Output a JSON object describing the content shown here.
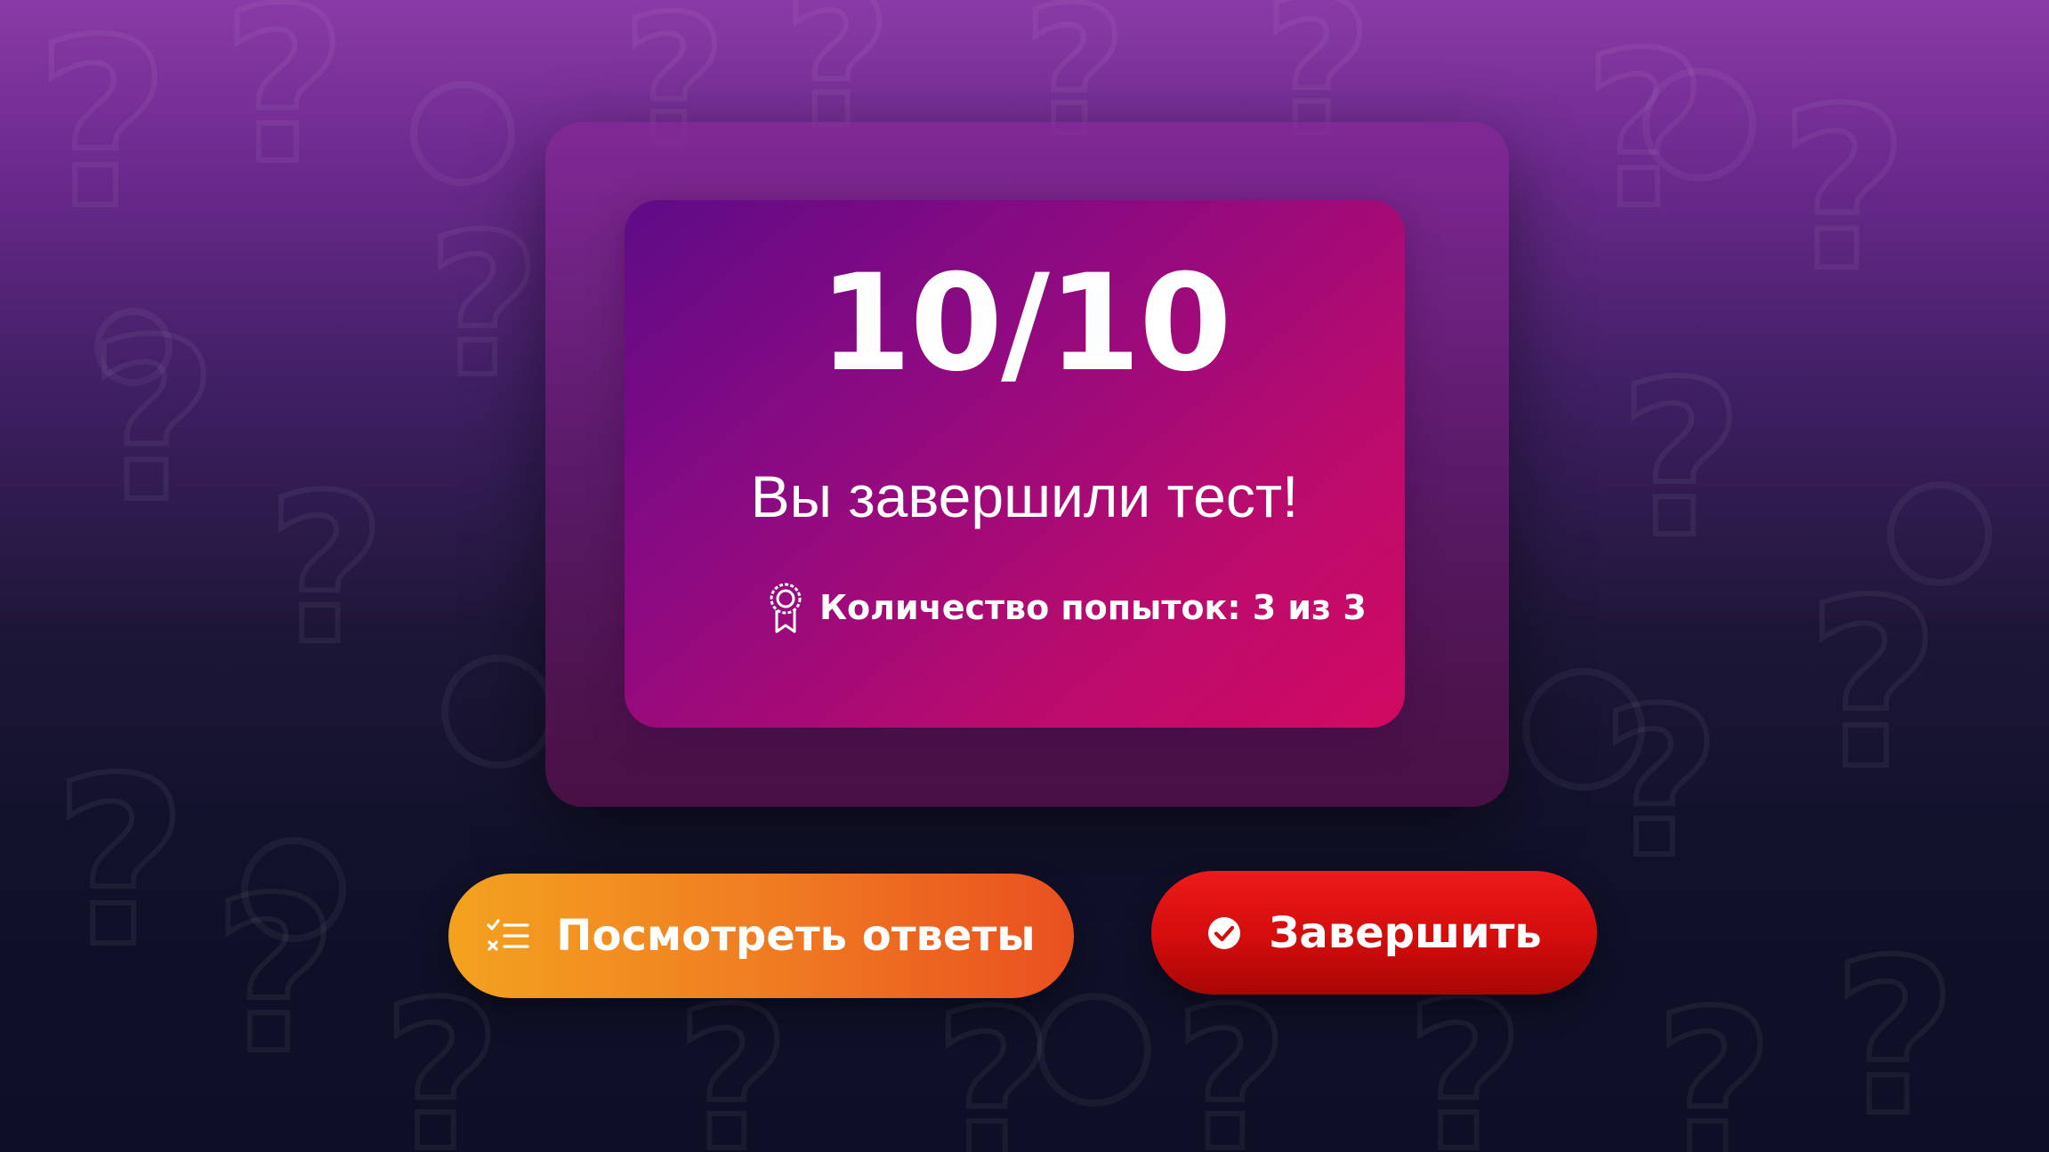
{
  "result": {
    "score": "10/10",
    "message": "Вы завершили тест!",
    "attempts_text": "Количество попыток: 3 из 3",
    "attempts_icon": "award-ribbon-icon"
  },
  "actions": {
    "review": {
      "label": "Посмотреть ответы",
      "icon": "checklist-icon",
      "color_from": "#f3a21f",
      "color_to": "#e9501f"
    },
    "finish": {
      "label": "Завершить",
      "icon": "check-circle-icon",
      "color_from": "#ee1a1a",
      "color_to": "#a80707"
    }
  },
  "theme": {
    "background_top": "#8a3aa6",
    "background_bottom": "#0c0f25",
    "panel_from": "#5e0b87",
    "panel_to": "#d20a62"
  }
}
